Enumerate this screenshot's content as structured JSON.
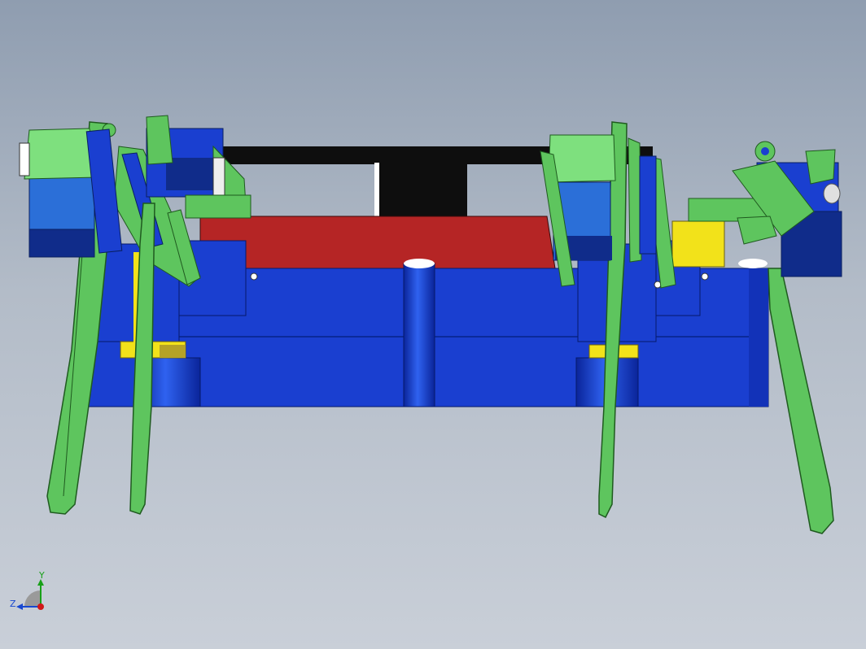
{
  "viewport": {
    "background_top": "#8f9db0",
    "background_bottom": "#c9cfd8"
  },
  "colors": {
    "body_blue": "#1a3fd0",
    "body_blue_dark": "#0b2a9a",
    "plate_red": "#b52525",
    "bar_black": "#0e0e0e",
    "servo_blue": "#2b6fd8",
    "servo_navy": "#102c8a",
    "leg_green": "#5ec55e",
    "leg_green_dark": "#1f5a1f",
    "bracket_light_green": "#7ee07e",
    "spacer_yellow": "#f2e21a"
  },
  "triad": {
    "x_label": "",
    "y_label": "Y",
    "z_label": "Z",
    "x_color": "#d01818",
    "y_color": "#18a018",
    "z_color": "#1848d0"
  }
}
